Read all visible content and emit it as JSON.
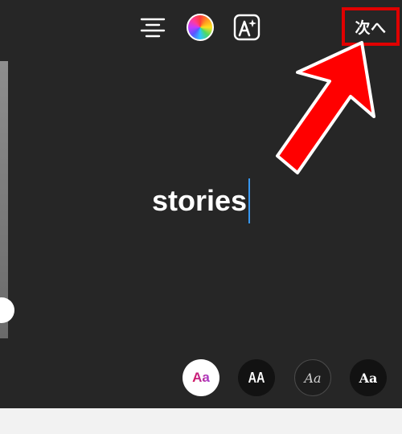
{
  "toolbar": {
    "align_icon": "align-center-icon",
    "color_icon": "color-wheel-icon",
    "effect_icon": "text-effect-sparkle-icon",
    "next_label": "次へ"
  },
  "annotation": {
    "arrow_icon": "red-arrow-icon",
    "highlight_color": "#e00000"
  },
  "editor": {
    "text": "stories",
    "caret_color": "#3797f0",
    "background_color": "#262626"
  },
  "size_slider": {
    "level": 0.32
  },
  "font_styles": [
    {
      "label": "Aa",
      "selected": true
    },
    {
      "label": "AA",
      "selected": false
    },
    {
      "label": "Aa",
      "selected": false
    },
    {
      "label": "Aa",
      "selected": false
    }
  ]
}
